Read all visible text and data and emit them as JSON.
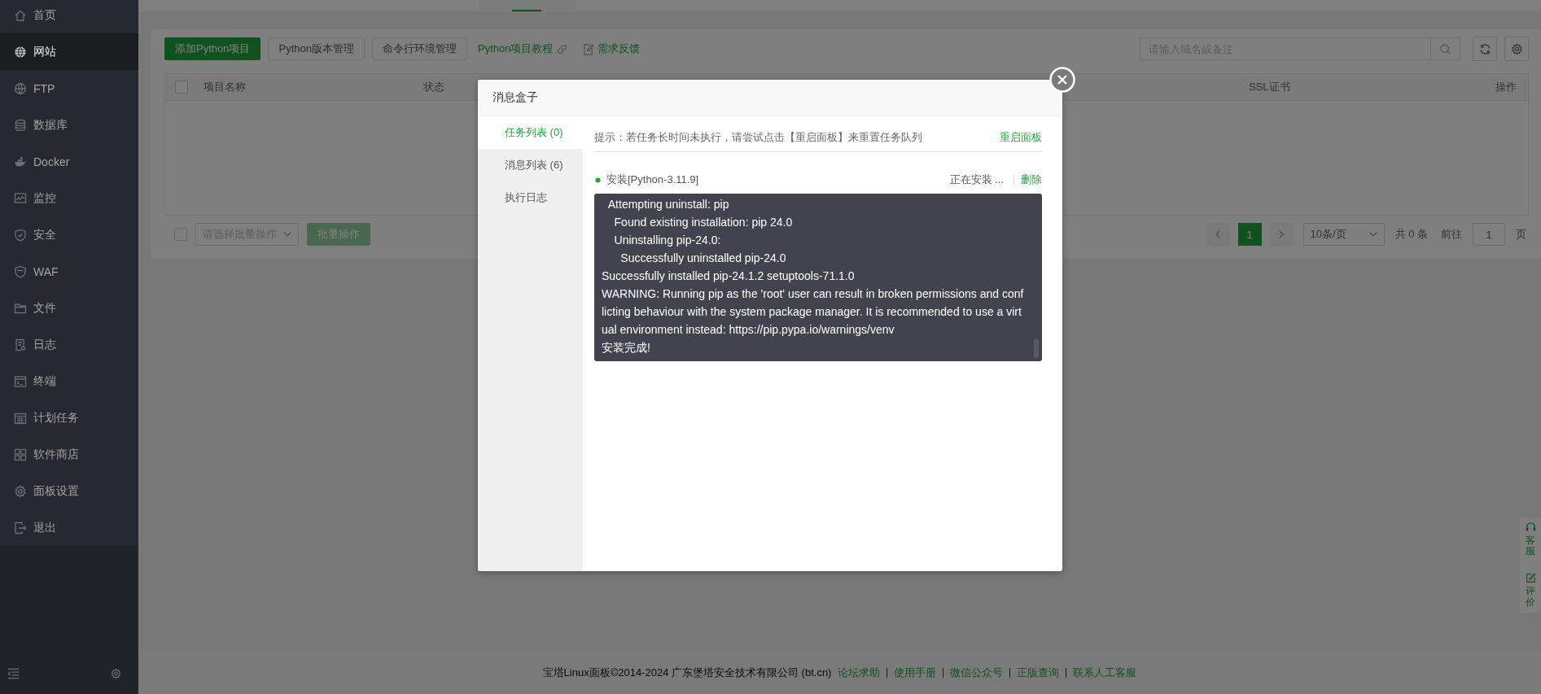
{
  "sidebar": {
    "items": [
      {
        "label": "首页",
        "selected": false
      },
      {
        "label": "网站",
        "selected": true
      },
      {
        "label": "FTP",
        "selected": false
      },
      {
        "label": "数据库",
        "selected": false
      },
      {
        "label": "Docker",
        "selected": false
      },
      {
        "label": "监控",
        "selected": false
      },
      {
        "label": "安全",
        "selected": false
      },
      {
        "label": "WAF",
        "selected": false
      },
      {
        "label": "文件",
        "selected": false
      },
      {
        "label": "日志",
        "selected": false
      },
      {
        "label": "终端",
        "selected": false
      },
      {
        "label": "计划任务",
        "selected": false
      },
      {
        "label": "软件商店",
        "selected": false
      },
      {
        "label": "面板设置",
        "selected": false
      },
      {
        "label": "退出",
        "selected": false
      }
    ]
  },
  "toolbar": {
    "buttons": [
      {
        "label": "添加Python项目",
        "kind": "primary"
      },
      {
        "label": "Python版本管理",
        "kind": "default"
      },
      {
        "label": "命令行环境管理",
        "kind": "default"
      },
      {
        "label": "Python项目教程",
        "kind": "link"
      },
      {
        "label": "需求反馈",
        "kind": "feedback"
      }
    ],
    "search": {
      "placeholder": "请输入域名或备注"
    }
  },
  "table": {
    "select_all": {
      "checked": false
    },
    "columns": [
      "项目名称",
      "状态",
      "SSL证书",
      "操作"
    ]
  },
  "pager": {
    "select_all": {
      "checked": false
    },
    "batch_select": {
      "placeholder": "请选择批量操作"
    },
    "batch_button": {
      "label": "批量操作",
      "disabled": true
    },
    "pages": [
      {
        "label": "1",
        "selected": true
      }
    ],
    "page_size": "10条/页",
    "total": "共 0 条",
    "goto_label": "前往",
    "goto_value": "1",
    "goto_suffix": "页"
  },
  "footer": {
    "copyright": "宝塔Linux面板©2014-2024 广东堡塔安全技术有限公司 (bt.cn)",
    "links": [
      "论坛求助",
      "使用手册",
      "微信公众号",
      "正版查询",
      "联系人工客服"
    ]
  },
  "float_panel": {
    "items": [
      {
        "label": "客服"
      },
      {
        "label": "评价"
      }
    ]
  },
  "dialog": {
    "title": "消息盒子",
    "tabs": [
      {
        "label": "任务列表 (0)",
        "selected": true
      },
      {
        "label": "消息列表 (6)",
        "selected": false
      },
      {
        "label": "执行日志",
        "selected": false
      }
    ],
    "hint": "提示：若任务长时间未执行，请尝试点击【重启面板】来重置任务队列",
    "hint_action": "重启面板",
    "tasks": [
      {
        "name": "安装[Python-3.11.9]",
        "status": "正在安装 ...",
        "action": "删除",
        "log": [
          "  Attempting uninstall: pip",
          "    Found existing installation: pip 24.0",
          "    Uninstalling pip-24.0:",
          "      Successfully uninstalled pip-24.0",
          "Successfully installed pip-24.1.2 setuptools-71.1.0",
          "WARNING: Running pip as the 'root' user can result in broken permissions and conflicting behaviour with the system package manager. It is recommended to use a virtual environment instead: https://pip.pypa.io/warnings/venv",
          "安装完成!"
        ]
      }
    ]
  }
}
